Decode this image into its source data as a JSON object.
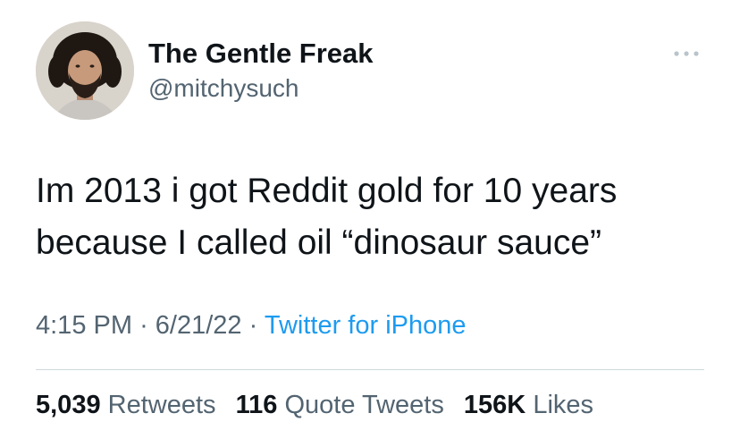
{
  "author": {
    "display_name": "The Gentle Freak",
    "handle": "@mitchysuch"
  },
  "tweet": {
    "text": "Im 2013 i got Reddit gold for 10 years\nbecause I called oil “dinosaur sauce”",
    "time": "4:15 PM",
    "date": "6/21/22",
    "separator": "·",
    "source": "Twitter for iPhone"
  },
  "stats": {
    "retweets_count": "5,039",
    "retweets_label": "Retweets",
    "quotes_count": "116",
    "quotes_label": "Quote Tweets",
    "likes_count": "156K",
    "likes_label": "Likes"
  },
  "colors": {
    "text": "#0f1419",
    "secondary": "#536471",
    "link": "#1d9bf0",
    "divider": "#cfd9de"
  },
  "icons": {
    "more": "more-horizontal-icon",
    "avatar": "profile-photo"
  }
}
